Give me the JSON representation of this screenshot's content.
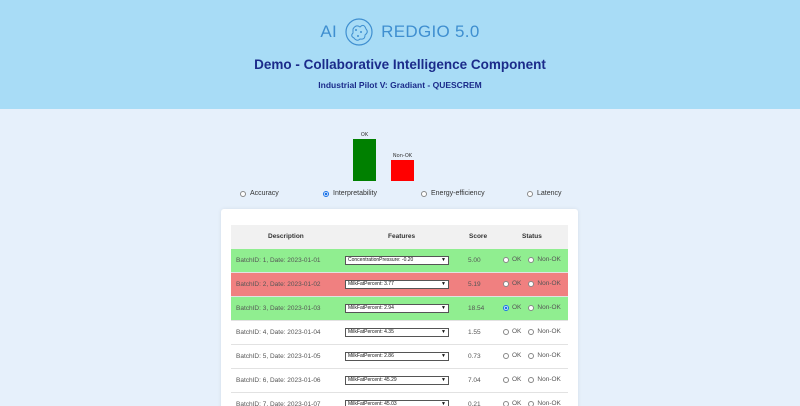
{
  "header": {
    "logo_left": "AI",
    "logo_right": "REDGIO 5.0",
    "title": "Demo - Collaborative Intelligence Component",
    "subtitle": "Industrial Pilot V: Gradiant - QUESCREM"
  },
  "chart_data": {
    "type": "bar",
    "categories": [
      "OK",
      "Non-OK"
    ],
    "values": [
      2,
      1
    ],
    "colors": [
      "#008000",
      "#ff0000"
    ],
    "title": "",
    "xlabel": "",
    "ylabel": ""
  },
  "metrics": {
    "options": [
      "Accuracy",
      "Interpretability",
      "Energy-efficiency",
      "Latency"
    ],
    "selected": "Interpretability"
  },
  "table": {
    "headers": [
      "Description",
      "Features",
      "Score",
      "Status"
    ],
    "status_options": [
      "OK",
      "Non-OK"
    ],
    "rows": [
      {
        "description": "BatchID: 1, Date: 2023-01-01",
        "feature": "ConcentrationPressure: -0.20",
        "score": "5.00",
        "status": "",
        "highlight": "ok"
      },
      {
        "description": "BatchID: 2, Date: 2023-01-02",
        "feature": "MilkFatPercent: 3.77",
        "score": "5.19",
        "status": "",
        "highlight": "nok"
      },
      {
        "description": "BatchID: 3, Date: 2023-01-03",
        "feature": "MilkFatPercent: 2.94",
        "score": "18.54",
        "status": "OK",
        "highlight": "ok"
      },
      {
        "description": "BatchID: 4, Date: 2023-01-04",
        "feature": "MilkFatPercent: 4.35",
        "score": "1.55",
        "status": "",
        "highlight": ""
      },
      {
        "description": "BatchID: 5, Date: 2023-01-05",
        "feature": "MilkFatPercent: 2.86",
        "score": "0.73",
        "status": "",
        "highlight": ""
      },
      {
        "description": "BatchID: 6, Date: 2023-01-06",
        "feature": "MilkFatPercent: 45.29",
        "score": "7.04",
        "status": "",
        "highlight": ""
      },
      {
        "description": "BatchID: 7, Date: 2023-01-07",
        "feature": "MilkFatPercent: 45.03",
        "score": "0.21",
        "status": "",
        "highlight": ""
      }
    ]
  }
}
